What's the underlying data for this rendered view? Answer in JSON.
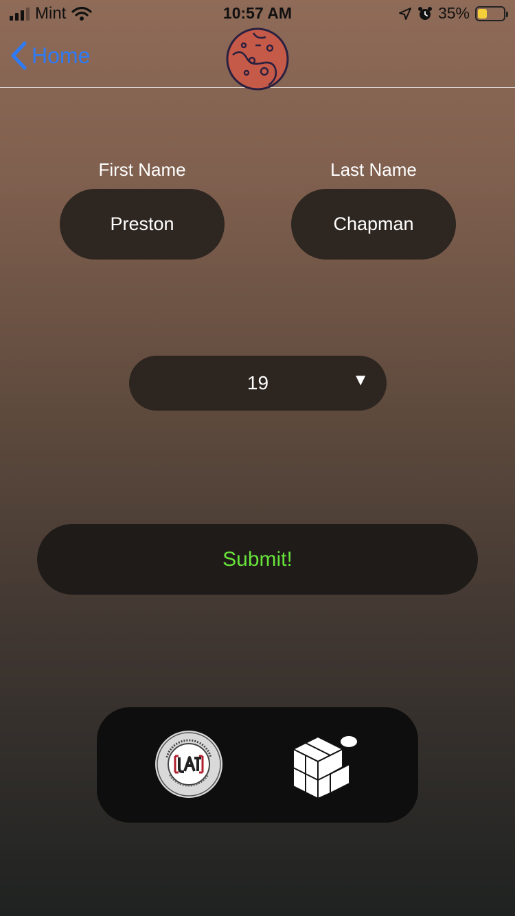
{
  "status_bar": {
    "carrier": "Mint",
    "time": "10:57 AM",
    "battery_percent": "35%",
    "battery_level": 0.35,
    "icons": [
      "signal-icon",
      "wifi-icon",
      "location-icon",
      "alarm-icon",
      "battery-icon"
    ]
  },
  "nav": {
    "back_label": "Home",
    "logo_icon": "planet-logo-icon"
  },
  "form": {
    "first_name_label": "First Name",
    "first_name_value": "Preston",
    "last_name_label": "Last Name",
    "last_name_value": "Chapman",
    "age_value": "19",
    "dropdown_arrow": "▼",
    "submit_label": "Submit!"
  },
  "footer": {
    "uat_logo_text": "University of Advancing Technology · UAT · Learn. Experience. Innovate.",
    "cube_logo_icon": "cube-logo-icon"
  },
  "colors": {
    "accent_blue": "#2f7bf5",
    "submit_green": "#67e33b",
    "planet_red": "#c65a48",
    "field_bg": "#2e2621",
    "battery_yellow": "#f5cf3a"
  }
}
